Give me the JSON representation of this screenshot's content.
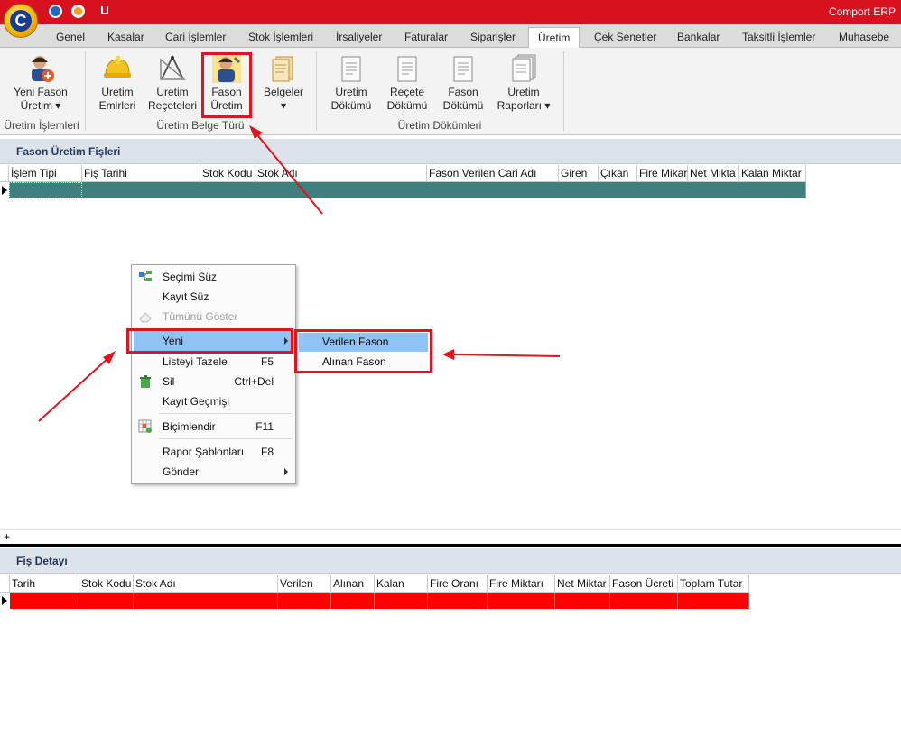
{
  "app": {
    "title": "Comport ERP",
    "logo_letter": "C"
  },
  "tabs": [
    "Genel",
    "Kasalar",
    "Cari İşlemler",
    "Stok İşlemleri",
    "İrsaliyeler",
    "Faturalar",
    "Siparişler",
    "Üretim",
    "Çek Senetler",
    "Bankalar",
    "Taksitli İşlemler",
    "Muhasebe"
  ],
  "active_tab": "Üretim",
  "ribbon": {
    "yeni_fason": {
      "line1": "Yeni Fason",
      "line2": "Üretim ▾"
    },
    "uretim_emirleri": {
      "line1": "Üretim",
      "line2": "Emirleri"
    },
    "uretim_receteleri": {
      "line1": "Üretim",
      "line2": "Reçeteleri"
    },
    "fason_uretim": {
      "line1": "Fason",
      "line2": "Üretim"
    },
    "belgeler": {
      "line1": "Belgeler",
      "line2": "▾"
    },
    "uretim_dokumu": {
      "line1": "Üretim",
      "line2": "Dökümü"
    },
    "recete_dokumu": {
      "line1": "Reçete",
      "line2": "Dökümü"
    },
    "fason_dokumu": {
      "line1": "Fason",
      "line2": "Dökümü"
    },
    "uretim_raporlari": {
      "line1": "Üretim",
      "line2": "Raporları ▾"
    },
    "groups": [
      "Üretim İşlemleri",
      "Üretim Belge Türü",
      "Üretim Dökümleri"
    ]
  },
  "fason_section": {
    "title": "Fason Üretim Fişleri",
    "columns": [
      "İşlem Tipi",
      "Fiş Tarihi",
      "Stok Kodu",
      "Stok Adı",
      "Fason Verilen Cari Adı",
      "Giren",
      "Çıkan",
      "Fire Mikar",
      "Net Mikta",
      "Kalan Miktar"
    ],
    "row_color": "#3f7f80"
  },
  "context_menu": {
    "items": [
      {
        "label": "Seçimi Süz",
        "shortcut": ""
      },
      {
        "label": "Kayıt Süz",
        "shortcut": ""
      },
      {
        "label": "Tümünü Göster",
        "shortcut": ""
      },
      {
        "label": "Yeni",
        "shortcut": ""
      },
      {
        "label": "Listeyi Tazele",
        "shortcut": "F5"
      },
      {
        "label": "Sil",
        "shortcut": "Ctrl+Del"
      },
      {
        "label": "Kayıt Geçmişi",
        "shortcut": ""
      },
      {
        "label": "Biçimlendir",
        "shortcut": "F11"
      },
      {
        "label": "Rapor Şablonları",
        "shortcut": "F8"
      },
      {
        "label": "Gönder",
        "shortcut": ""
      }
    ],
    "submenu": [
      "Verilen Fason",
      "Alınan Fason"
    ]
  },
  "detail_section": {
    "title": "Fiş Detayı",
    "columns": [
      "Tarih",
      "Stok Kodu",
      "Stok Adı",
      "Verilen",
      "Alınan",
      "Kalan",
      "Fire Oranı",
      "Fire Miktarı",
      "Net Miktar",
      "Fason Ücreti",
      "Toplam Tutar"
    ],
    "row_color": "#ff0000"
  },
  "footer_plus": "+",
  "colors": {
    "title_bar": "#d8111f",
    "highlight": "#8ec3f3",
    "annotation": "#e0141e"
  }
}
